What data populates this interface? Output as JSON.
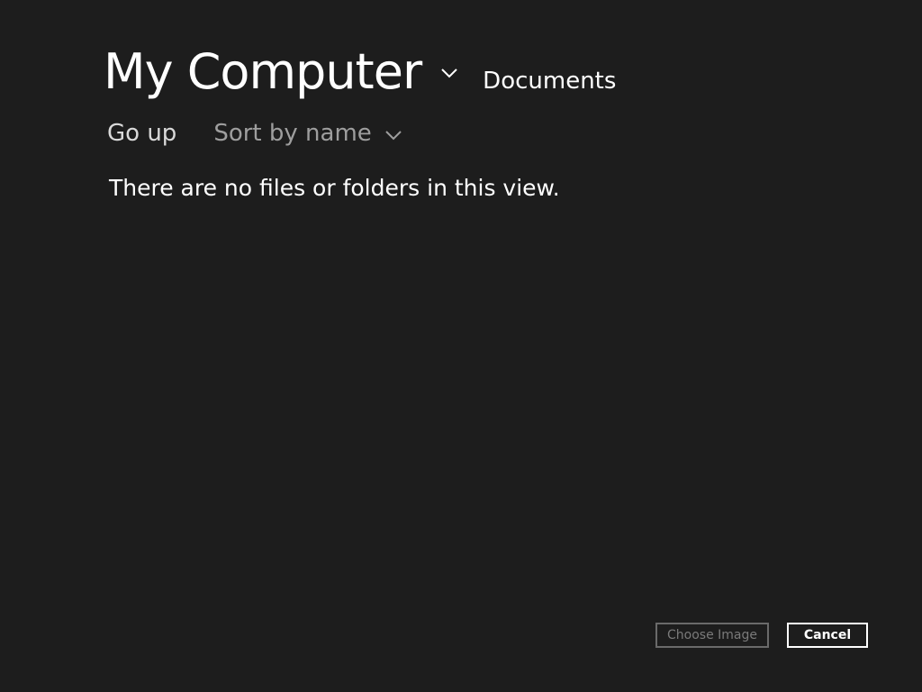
{
  "header": {
    "location_title": "My Computer",
    "location_dropdown_icon": "chevron-down-icon",
    "current_folder": "Documents"
  },
  "toolbar": {
    "go_up_label": "Go up",
    "sort_label": "Sort by name",
    "sort_dropdown_icon": "chevron-down-icon"
  },
  "content": {
    "empty_message": "There are no files or folders in this view."
  },
  "footer": {
    "choose_label": "Choose Image",
    "choose_enabled": false,
    "cancel_label": "Cancel"
  },
  "colors": {
    "background": "#1d1d1d",
    "text_primary": "#ffffff",
    "text_secondary": "#9e9e9e",
    "disabled": "#6a6a6a"
  }
}
